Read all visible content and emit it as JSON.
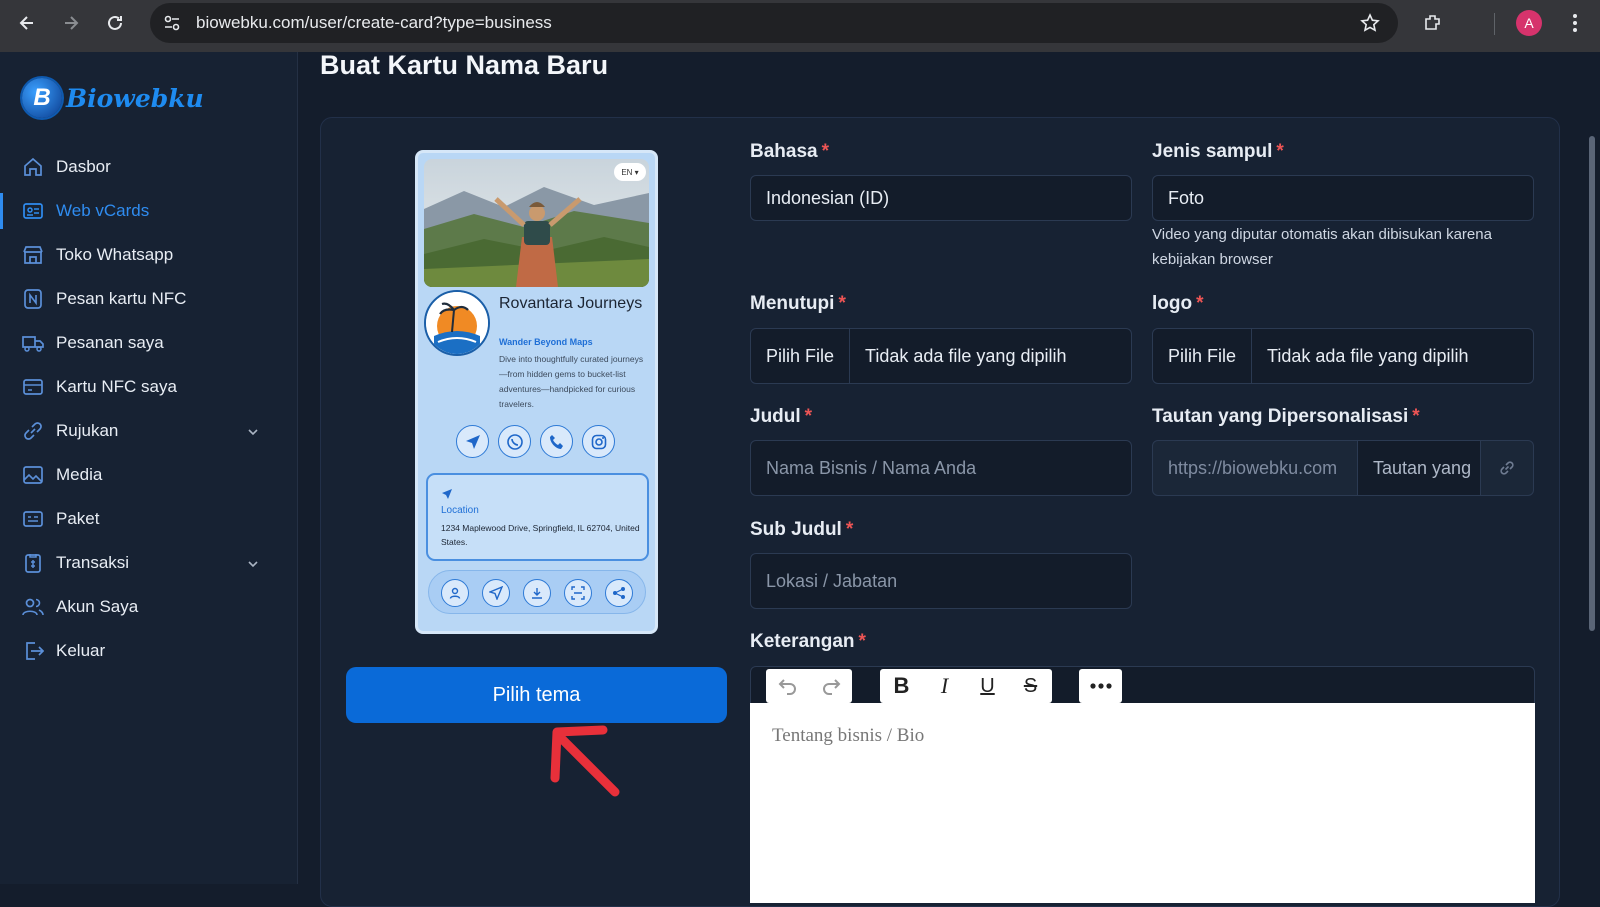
{
  "browser": {
    "url": "biowebku.com/user/create-card?type=business",
    "profile_initial": "A"
  },
  "sidebar": {
    "logo_letter": "B",
    "logo_text": "Biowebku",
    "items": [
      {
        "label": "Dasbor",
        "icon": "home-icon"
      },
      {
        "label": "Web vCards",
        "icon": "id-card-icon",
        "active": true
      },
      {
        "label": "Toko Whatsapp",
        "icon": "store-icon"
      },
      {
        "label": "Pesan kartu NFC",
        "icon": "nfc-icon"
      },
      {
        "label": "Pesanan saya",
        "icon": "truck-icon"
      },
      {
        "label": "Kartu NFC saya",
        "icon": "card-icon"
      },
      {
        "label": "Rujukan",
        "icon": "link-icon",
        "expandable": true
      },
      {
        "label": "Media",
        "icon": "image-icon"
      },
      {
        "label": "Paket",
        "icon": "package-icon"
      },
      {
        "label": "Transaksi",
        "icon": "receipt-icon",
        "expandable": true
      },
      {
        "label": "Akun Saya",
        "icon": "users-icon"
      },
      {
        "label": "Keluar",
        "icon": "logout-icon"
      }
    ]
  },
  "page": {
    "title": "Buat Kartu Nama Baru"
  },
  "preview": {
    "lang": "EN",
    "name": "Rovantara Journeys",
    "tagline": "Wander Beyond Maps",
    "description": "Dive into thoughtfully curated journeys—from hidden gems to bucket-list adventures—handpicked for curious travelers.",
    "location_title": "Location",
    "location_address": "1234 Maplewood Drive, Springfield, IL 62704, United States."
  },
  "choose_theme_label": "Pilih tema",
  "form": {
    "required_mark": "*",
    "bahasa": {
      "label": "Bahasa",
      "value": "Indonesian (ID)"
    },
    "jenis_sampul": {
      "label": "Jenis sampul",
      "value": "Foto",
      "help": "Video yang diputar otomatis akan dibisukan karena kebijakan browser"
    },
    "menutupi": {
      "label": "Menutupi",
      "button": "Pilih File",
      "file": "Tidak ada file yang dipilih"
    },
    "logo": {
      "label": "logo",
      "button": "Pilih File",
      "file": "Tidak ada file yang dipilih"
    },
    "judul": {
      "label": "Judul",
      "placeholder": "Nama Bisnis / Nama Anda"
    },
    "tautan": {
      "label": "Tautan yang Dipersonalisasi",
      "prefix": "https://biowebku.com",
      "placeholder": "Tautan yang"
    },
    "sub_judul": {
      "label": "Sub Judul",
      "placeholder": "Lokasi / Jabatan"
    },
    "keterangan": {
      "label": "Keterangan",
      "placeholder": "Tentang bisnis / Bio"
    }
  },
  "colors": {
    "accent": "#0a6ad8",
    "active_menu": "#2f8cf0",
    "required": "#ee5555",
    "annotation_arrow": "#e8303a"
  }
}
